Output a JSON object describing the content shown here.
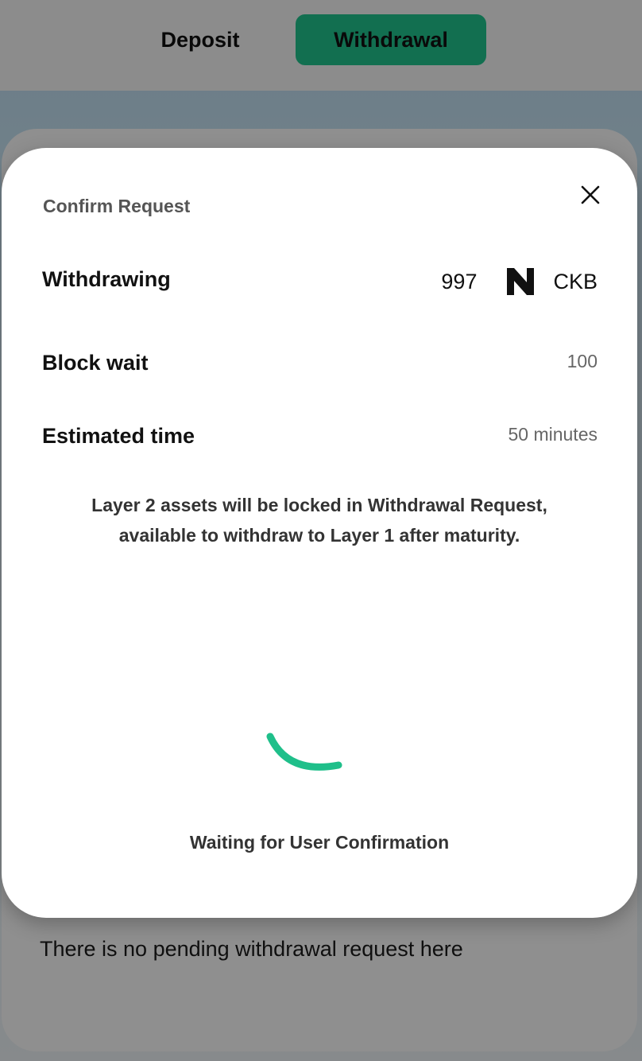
{
  "tabs": {
    "deposit_label": "Deposit",
    "withdrawal_label": "Withdrawal",
    "active": "withdrawal",
    "active_color": "#1fbf8a"
  },
  "background": {
    "empty_message": "There is no pending withdrawal request here"
  },
  "modal": {
    "title": "Confirm Request",
    "close_icon": "close-icon",
    "withdrawing": {
      "label": "Withdrawing",
      "amount": "997",
      "token_icon": "ckb-token-icon",
      "token": "CKB"
    },
    "block_wait": {
      "label": "Block wait",
      "value": "100"
    },
    "estimated_time": {
      "label": "Estimated time",
      "value": "50 minutes"
    },
    "note_line1": "Layer 2 assets will be locked in Withdrawal Request,",
    "note_line2": "available to withdraw to Layer 1 after maturity.",
    "spinner_icon": "loading-spinner-icon",
    "spinner_color": "#1fbf8a",
    "status": "Waiting for User Confirmation"
  }
}
